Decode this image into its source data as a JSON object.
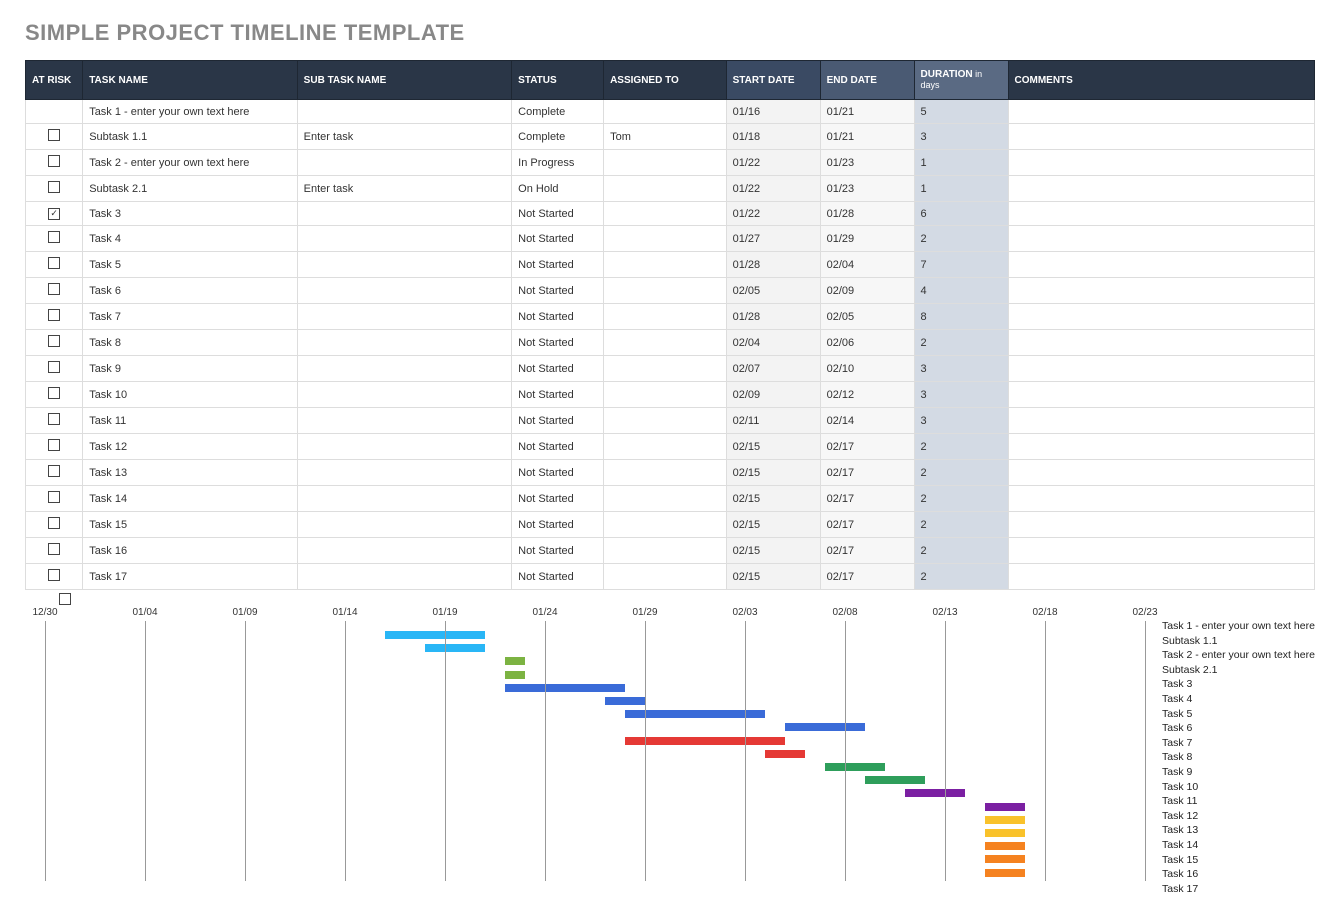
{
  "title": "SIMPLE PROJECT TIMELINE TEMPLATE",
  "headers": {
    "risk": "AT RISK",
    "task": "TASK NAME",
    "sub": "SUB TASK NAME",
    "status": "STATUS",
    "assigned": "ASSIGNED TO",
    "start": "START DATE",
    "end": "END DATE",
    "duration": "DURATION",
    "duration_sub": " in days",
    "comments": "COMMENTS"
  },
  "rows": [
    {
      "risk": "",
      "task": "Task 1 - enter your own text here",
      "sub": "",
      "status": "Complete",
      "assigned": "",
      "start": "01/16",
      "end": "01/21",
      "dur": "5",
      "comments": ""
    },
    {
      "risk": "false",
      "task": "Subtask 1.1",
      "sub": "Enter task",
      "status": "Complete",
      "assigned": "Tom",
      "start": "01/18",
      "end": "01/21",
      "dur": "3",
      "comments": ""
    },
    {
      "risk": "false",
      "task": "Task 2 - enter your own text here",
      "sub": "",
      "status": "In Progress",
      "assigned": "",
      "start": "01/22",
      "end": "01/23",
      "dur": "1",
      "comments": ""
    },
    {
      "risk": "false",
      "task": "Subtask 2.1",
      "sub": "Enter task",
      "status": "On Hold",
      "assigned": "",
      "start": "01/22",
      "end": "01/23",
      "dur": "1",
      "comments": ""
    },
    {
      "risk": "true",
      "task": "Task 3",
      "sub": "",
      "status": "Not Started",
      "assigned": "",
      "start": "01/22",
      "end": "01/28",
      "dur": "6",
      "comments": ""
    },
    {
      "risk": "false",
      "task": "Task 4",
      "sub": "",
      "status": "Not Started",
      "assigned": "",
      "start": "01/27",
      "end": "01/29",
      "dur": "2",
      "comments": ""
    },
    {
      "risk": "false",
      "task": "Task 5",
      "sub": "",
      "status": "Not Started",
      "assigned": "",
      "start": "01/28",
      "end": "02/04",
      "dur": "7",
      "comments": ""
    },
    {
      "risk": "false",
      "task": "Task 6",
      "sub": "",
      "status": "Not Started",
      "assigned": "",
      "start": "02/05",
      "end": "02/09",
      "dur": "4",
      "comments": ""
    },
    {
      "risk": "false",
      "task": "Task 7",
      "sub": "",
      "status": "Not Started",
      "assigned": "",
      "start": "01/28",
      "end": "02/05",
      "dur": "8",
      "comments": ""
    },
    {
      "risk": "false",
      "task": "Task 8",
      "sub": "",
      "status": "Not Started",
      "assigned": "",
      "start": "02/04",
      "end": "02/06",
      "dur": "2",
      "comments": ""
    },
    {
      "risk": "false",
      "task": "Task 9",
      "sub": "",
      "status": "Not Started",
      "assigned": "",
      "start": "02/07",
      "end": "02/10",
      "dur": "3",
      "comments": ""
    },
    {
      "risk": "false",
      "task": "Task 10",
      "sub": "",
      "status": "Not Started",
      "assigned": "",
      "start": "02/09",
      "end": "02/12",
      "dur": "3",
      "comments": ""
    },
    {
      "risk": "false",
      "task": "Task 11",
      "sub": "",
      "status": "Not Started",
      "assigned": "",
      "start": "02/11",
      "end": "02/14",
      "dur": "3",
      "comments": ""
    },
    {
      "risk": "false",
      "task": "Task 12",
      "sub": "",
      "status": "Not Started",
      "assigned": "",
      "start": "02/15",
      "end": "02/17",
      "dur": "2",
      "comments": ""
    },
    {
      "risk": "false",
      "task": "Task 13",
      "sub": "",
      "status": "Not Started",
      "assigned": "",
      "start": "02/15",
      "end": "02/17",
      "dur": "2",
      "comments": ""
    },
    {
      "risk": "false",
      "task": "Task 14",
      "sub": "",
      "status": "Not Started",
      "assigned": "",
      "start": "02/15",
      "end": "02/17",
      "dur": "2",
      "comments": ""
    },
    {
      "risk": "false",
      "task": "Task 15",
      "sub": "",
      "status": "Not Started",
      "assigned": "",
      "start": "02/15",
      "end": "02/17",
      "dur": "2",
      "comments": ""
    },
    {
      "risk": "false",
      "task": "Task 16",
      "sub": "",
      "status": "Not Started",
      "assigned": "",
      "start": "02/15",
      "end": "02/17",
      "dur": "2",
      "comments": ""
    },
    {
      "risk": "false",
      "task": "Task 17",
      "sub": "",
      "status": "Not Started",
      "assigned": "",
      "start": "02/15",
      "end": "02/17",
      "dur": "2",
      "comments": ""
    }
  ],
  "chart_data": {
    "type": "bar",
    "x_ticks": [
      "12/30",
      "01/04",
      "01/09",
      "01/14",
      "01/19",
      "01/24",
      "01/29",
      "02/03",
      "02/08",
      "02/13",
      "02/18",
      "02/23"
    ],
    "x_min": "12/30",
    "x_max": "02/23",
    "series": [
      {
        "name": "Task 1 - enter your own text here",
        "start": "01/16",
        "end": "01/21",
        "color": "#29b6f6"
      },
      {
        "name": "Subtask 1.1",
        "start": "01/18",
        "end": "01/21",
        "color": "#29b6f6"
      },
      {
        "name": "Task 2 - enter your own text here",
        "start": "01/22",
        "end": "01/23",
        "color": "#7cb342"
      },
      {
        "name": "Subtask 2.1",
        "start": "01/22",
        "end": "01/23",
        "color": "#7cb342"
      },
      {
        "name": "Task 3",
        "start": "01/22",
        "end": "01/28",
        "color": "#3a6bd8"
      },
      {
        "name": "Task 4",
        "start": "01/27",
        "end": "01/29",
        "color": "#3a6bd8"
      },
      {
        "name": "Task 5",
        "start": "01/28",
        "end": "02/04",
        "color": "#3a6bd8"
      },
      {
        "name": "Task 6",
        "start": "02/05",
        "end": "02/09",
        "color": "#3a6bd8"
      },
      {
        "name": "Task 7",
        "start": "01/28",
        "end": "02/05",
        "color": "#e53935"
      },
      {
        "name": "Task 8",
        "start": "02/04",
        "end": "02/06",
        "color": "#e53935"
      },
      {
        "name": "Task 9",
        "start": "02/07",
        "end": "02/10",
        "color": "#2e9e5b"
      },
      {
        "name": "Task 10",
        "start": "02/09",
        "end": "02/12",
        "color": "#2e9e5b"
      },
      {
        "name": "Task 11",
        "start": "02/11",
        "end": "02/14",
        "color": "#7b1fa2"
      },
      {
        "name": "Task 12",
        "start": "02/15",
        "end": "02/17",
        "color": "#7b1fa2"
      },
      {
        "name": "Task 13",
        "start": "02/15",
        "end": "02/17",
        "color": "#f9c22b"
      },
      {
        "name": "Task 14",
        "start": "02/15",
        "end": "02/17",
        "color": "#f9c22b"
      },
      {
        "name": "Task 15",
        "start": "02/15",
        "end": "02/17",
        "color": "#f58220"
      },
      {
        "name": "Task 16",
        "start": "02/15",
        "end": "02/17",
        "color": "#f58220"
      },
      {
        "name": "Task 17",
        "start": "02/15",
        "end": "02/17",
        "color": "#f58220"
      }
    ]
  }
}
